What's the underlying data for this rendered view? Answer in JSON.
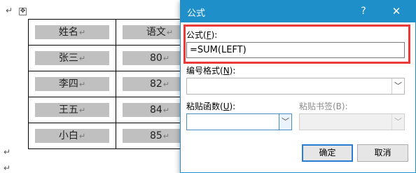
{
  "document": {
    "move_handle_glyph": "✥",
    "paragraph_mark": "↵",
    "table": {
      "headers": [
        "姓名",
        "语文"
      ],
      "rows": [
        [
          "张三",
          "80"
        ],
        [
          "李四",
          "82"
        ],
        [
          "王五",
          "84"
        ],
        [
          "小白",
          "85"
        ]
      ],
      "cell_mark": "↵"
    }
  },
  "dialog": {
    "title": "公式",
    "help_glyph": "?",
    "close_glyph": "✕",
    "formula_label": "公式(",
    "formula_hotkey": "F",
    "formula_label_end": "):",
    "formula_value": "=SUM(LEFT)",
    "number_format_label": "编号格式(",
    "number_format_hotkey": "N",
    "number_format_label_end": "):",
    "number_format_value": "",
    "paste_function_label": "粘贴函数(",
    "paste_function_hotkey": "U",
    "paste_function_label_end": "):",
    "paste_function_value": "",
    "paste_bookmark_label": "粘贴书签(B):",
    "paste_bookmark_value": "",
    "dropdown_glyph": "﹀",
    "ok_label": "确定",
    "cancel_label": "取消"
  }
}
